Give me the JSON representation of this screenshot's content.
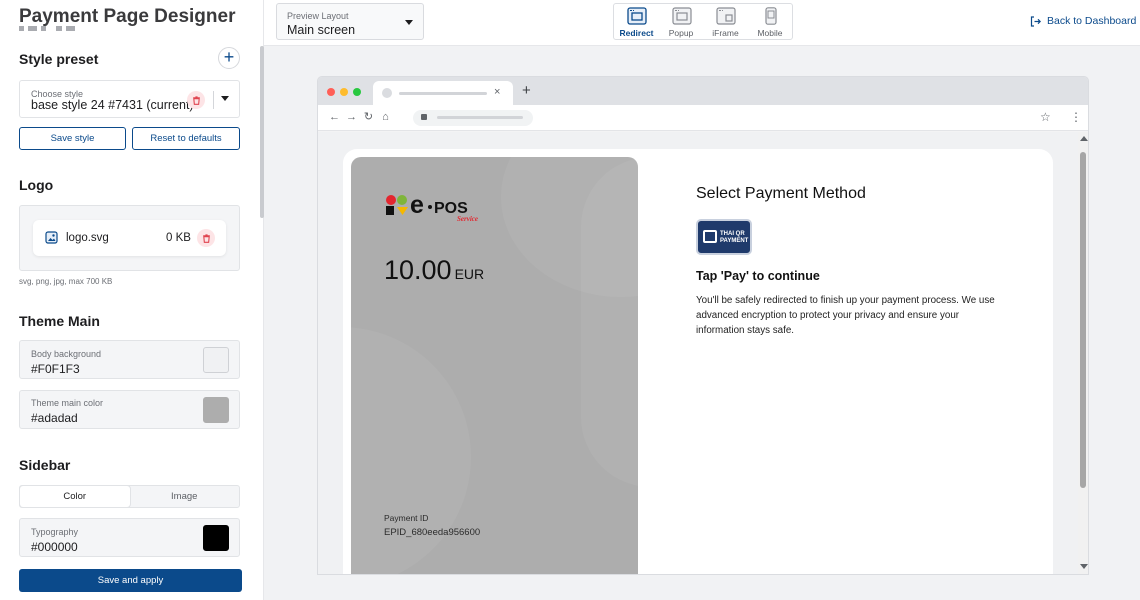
{
  "app": {
    "title": "Payment Page Designer",
    "back_label": "Back to Dashboard"
  },
  "style_preset": {
    "title": "Style preset",
    "choose_label": "Choose style",
    "selected": "base style 24 #7431 (current)",
    "save_label": "Save style",
    "reset_label": "Reset to defaults"
  },
  "logo": {
    "title": "Logo",
    "file_name": "logo.svg",
    "file_size": "0 KB",
    "hint": "svg, png, jpg, max 700 KB"
  },
  "theme_main": {
    "title": "Theme Main",
    "body_bg_label": "Body background",
    "body_bg_value": "#F0F1F3",
    "main_color_label": "Theme main color",
    "main_color_value": "#adadad"
  },
  "sidebar_section": {
    "title": "Sidebar",
    "tab_color": "Color",
    "tab_image": "Image",
    "typography_label": "Typography",
    "typography_value": "#000000"
  },
  "save_apply_label": "Save and apply",
  "preview_layout": {
    "label": "Preview Layout",
    "value": "Main screen"
  },
  "modes": [
    {
      "label": "Redirect",
      "active": true
    },
    {
      "label": "Popup",
      "active": false
    },
    {
      "label": "iFrame",
      "active": false
    },
    {
      "label": "Mobile",
      "active": false
    }
  ],
  "browser": {
    "tab_close": "×",
    "new_tab": "+"
  },
  "payment": {
    "brand_main": "e·pos",
    "brand_sub": "Service",
    "amount": "10.00",
    "currency": "EUR",
    "id_label": "Payment ID",
    "id_value": "EPID_680eeda956600",
    "method_title": "Select Payment Method",
    "badge_line1": "THAI QR",
    "badge_line2": "PAYMENT",
    "tap_title": "Tap 'Pay' to continue",
    "description": "You'll be safely redirected to finish up your payment process. We use advanced encryption to protect your privacy and ensure your information stays safe."
  },
  "colors": {
    "accent": "#0b4a8b",
    "theme_main": "#adadad",
    "body_background": "#F0F1F3",
    "typography": "#000000",
    "danger_bg": "#fde4e6",
    "danger": "#e0434f"
  },
  "icons": [
    "plus-icon",
    "trash-icon",
    "chevron-down-icon",
    "file-image-icon",
    "logout-icon",
    "browser-window-icon",
    "mobile-icon",
    "star-icon",
    "kebab-icon"
  ]
}
